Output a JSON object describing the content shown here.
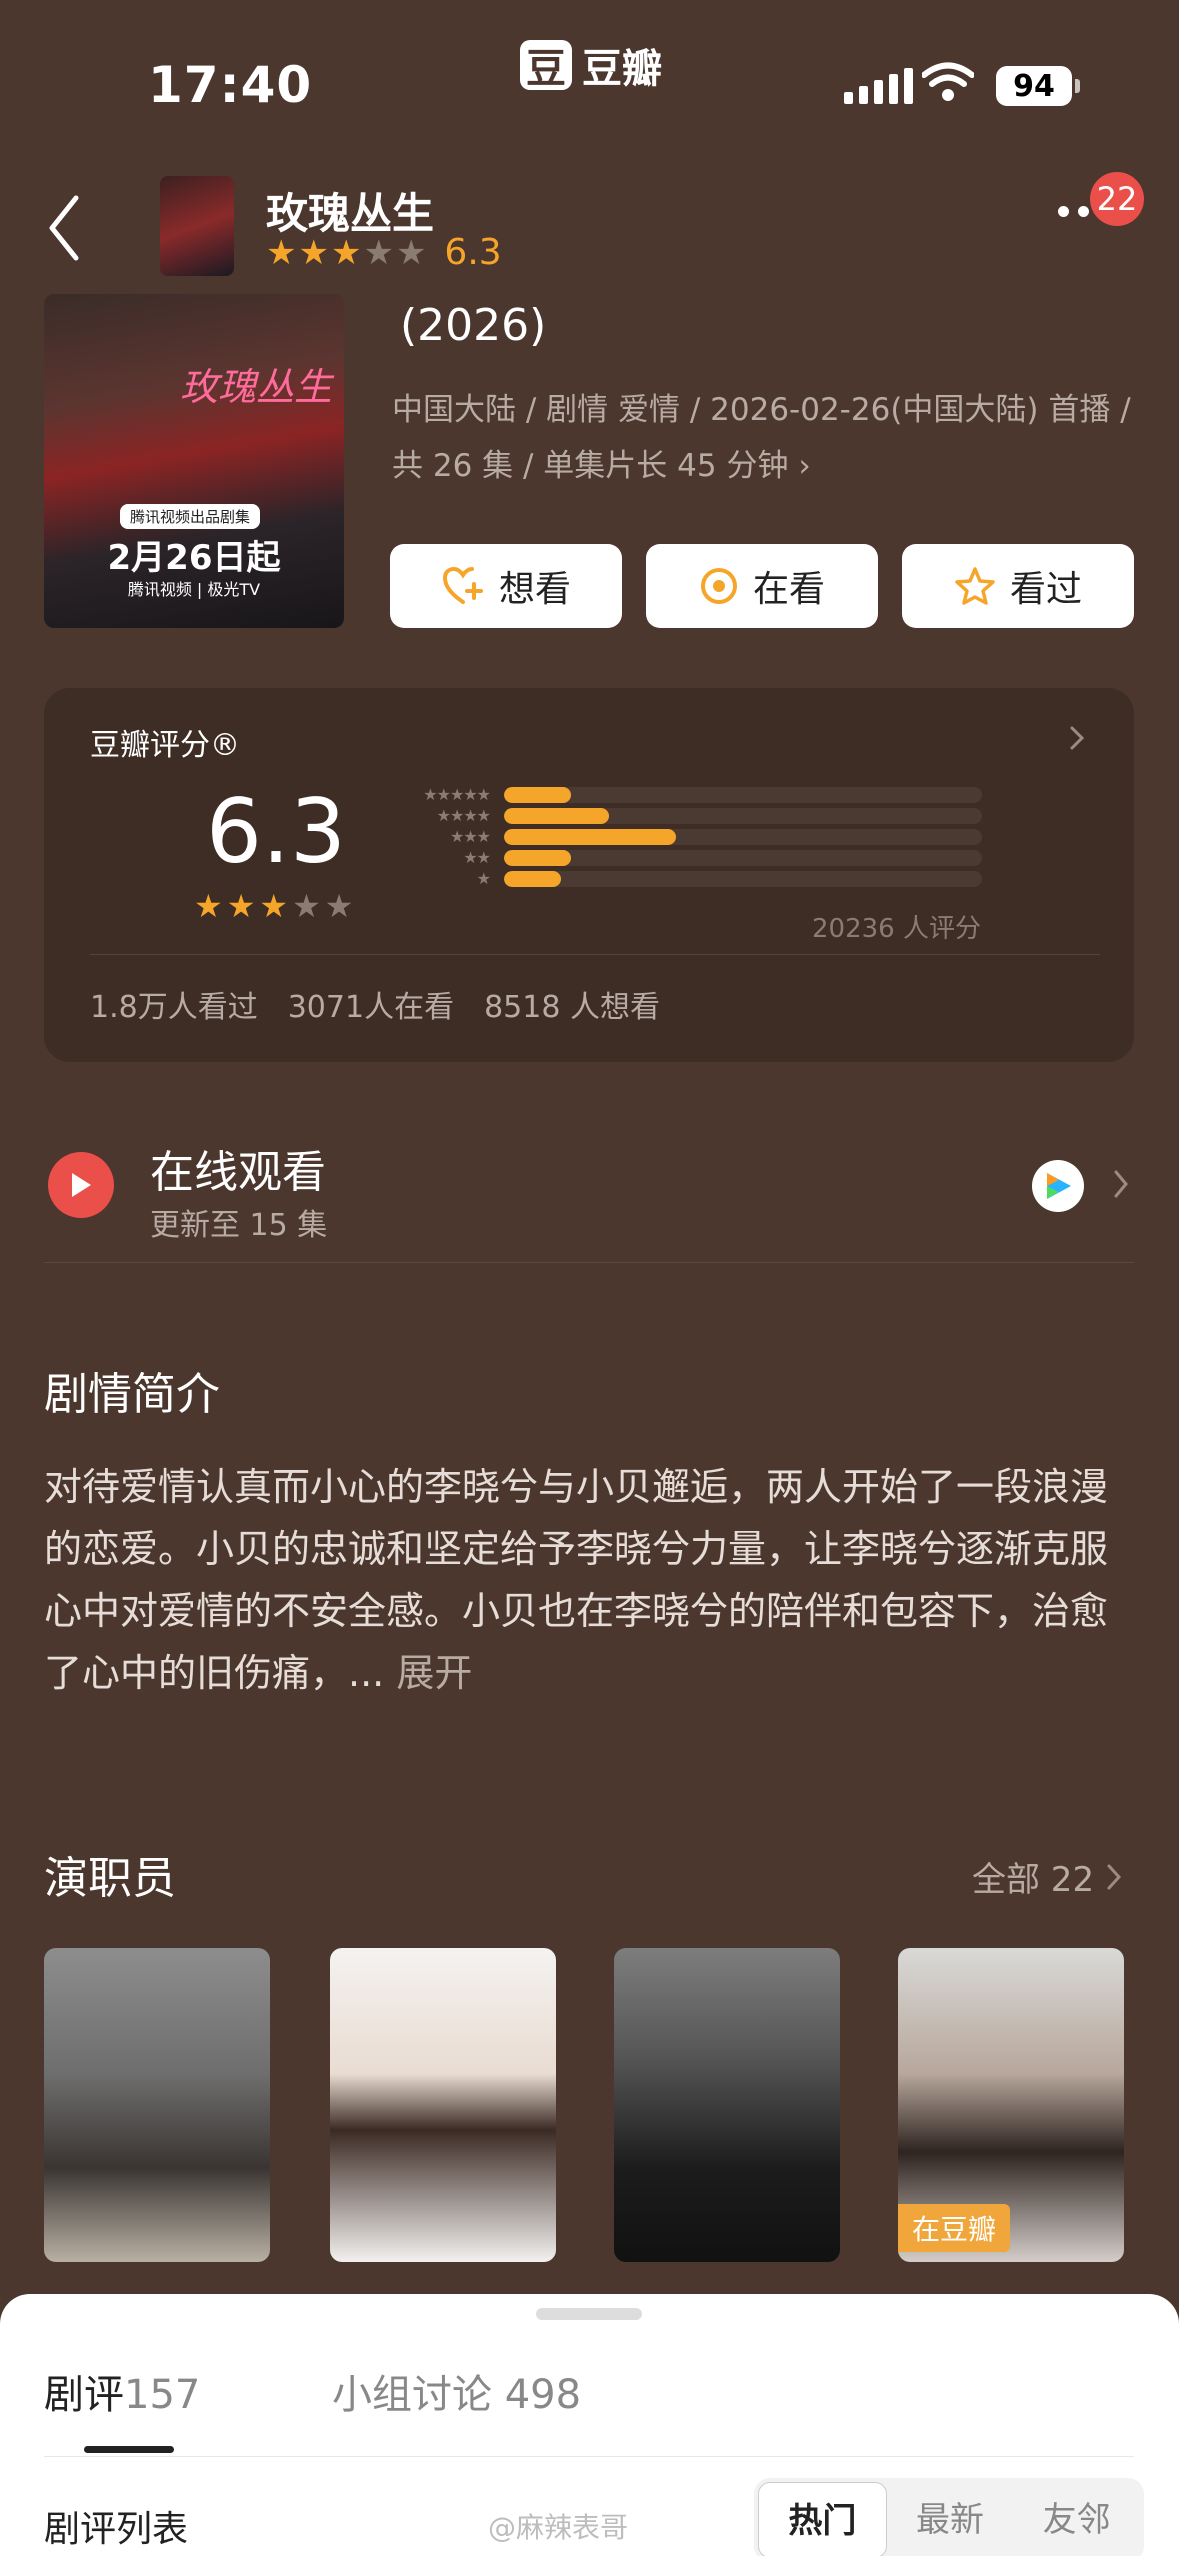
{
  "status": {
    "time": "17:40",
    "app_badge": "豆",
    "app_name": "豆瓣",
    "battery": "94"
  },
  "nav": {
    "title": "玫瑰丛生",
    "rating": 3,
    "score": "6.3",
    "badge": "22"
  },
  "poster": {
    "title": "玫瑰丛生",
    "tag": "腾讯视频出品剧集",
    "date": "2月26日起",
    "platforms": "腾讯视频 | 极光TV"
  },
  "header": {
    "year": "(2026)",
    "info": "中国大陆 / 剧情 爱情 / 2026-02-26(中国大陆) 首播 / 共 26 集 / 单集片长 45 分钟",
    "info_arrow": "›"
  },
  "actions": [
    {
      "label": "想看",
      "icon": "heart-plus-icon"
    },
    {
      "label": "在看",
      "icon": "target-icon"
    },
    {
      "label": "看过",
      "icon": "star-outline-icon"
    }
  ],
  "rating_card": {
    "title": "豆瓣评分®",
    "score": "6.3",
    "stars": 3,
    "distribution": [
      {
        "stars": 5,
        "percent": 14
      },
      {
        "stars": 4,
        "percent": 22
      },
      {
        "stars": 3,
        "percent": 36
      },
      {
        "stars": 2,
        "percent": 14
      },
      {
        "stars": 1,
        "percent": 12
      }
    ],
    "count": "20236 人评分",
    "stats": [
      "1.8万人看过",
      "3071人在看",
      "8518 人想看"
    ]
  },
  "watch": {
    "title": "在线观看",
    "subtitle": "更新至 15 集"
  },
  "synopsis": {
    "heading": "剧情简介",
    "text": "对待爱情认真而小心的李晓兮与小贝邂逅，两人开始了一段浪漫的恋爱。小贝的忠诚和坚定给予李晓兮力量，让李晓兮逐渐克服心中对爱情的不安全感。小贝也在李晓兮的陪伴和包容下，治愈了心中的旧伤痛，... ",
    "expand": "展开"
  },
  "cast": {
    "heading": "演职员",
    "all_label": "全部 22",
    "tag": "在豆瓣"
  },
  "sheet": {
    "tabs": [
      {
        "label": "剧评",
        "count": "157"
      },
      {
        "label": "小组讨论",
        "count": "498"
      }
    ],
    "list_label": "剧评列表",
    "watermark": "@麻辣表哥",
    "sort_options": [
      "热门",
      "最新",
      "友邻"
    ],
    "active_sort": "热门"
  },
  "colors": {
    "background": "#4b372e",
    "card": "#3d2d25",
    "accent": "#f5a62a",
    "badge": "#ea4f4a"
  }
}
